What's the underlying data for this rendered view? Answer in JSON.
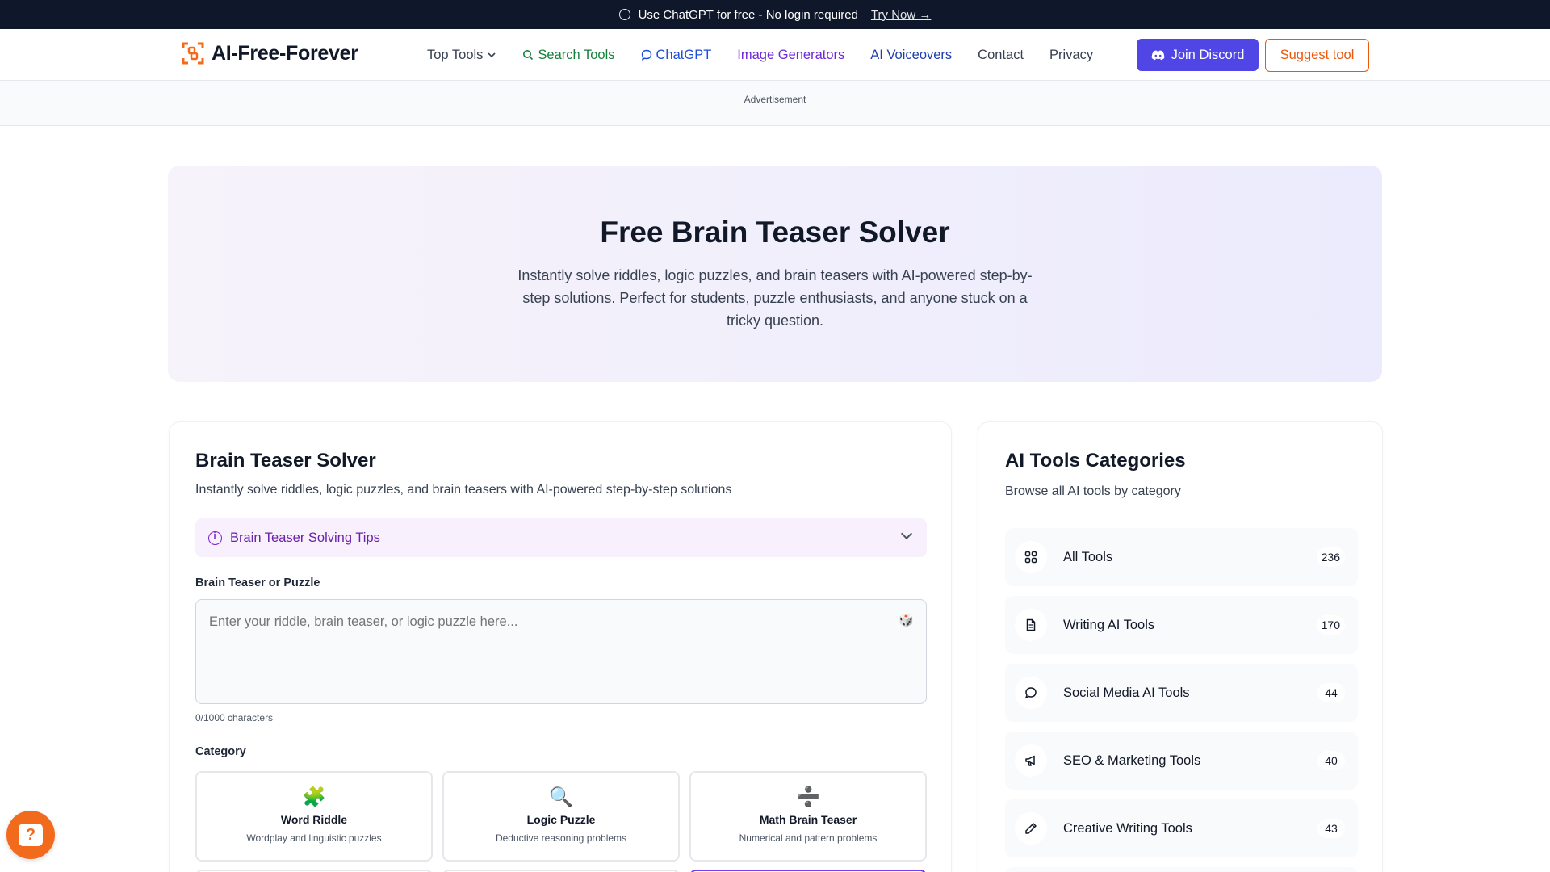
{
  "banner": {
    "text": "Use ChatGPT for free - No login required",
    "link": "Try Now →"
  },
  "brand": {
    "name": "AI-Free-Forever",
    "accent": "#f26b1d"
  },
  "nav": {
    "items": [
      {
        "label": "Top Tools",
        "icon": "chevron-down-icon"
      },
      {
        "label": "Search Tools",
        "icon": "search-icon"
      },
      {
        "label": "ChatGPT",
        "icon": "chat-icon"
      },
      {
        "label": "Image Generators"
      },
      {
        "label": "AI Voiceovers"
      },
      {
        "label": "Contact"
      },
      {
        "label": "Privacy"
      }
    ],
    "discord": "Join Discord",
    "suggest": "Suggest tool"
  },
  "ad_label": "Advertisement",
  "hero": {
    "title": "Free Brain Teaser Solver",
    "description": "Instantly solve riddles, logic puzzles, and brain teasers with AI-powered step-by-step solutions. Perfect for students, puzzle enthusiasts, and anyone stuck on a tricky question."
  },
  "solver": {
    "title": "Brain Teaser Solver",
    "subtitle": "Instantly solve riddles, logic puzzles, and brain teasers with AI-powered step-by-step solutions",
    "tips_label": "Brain Teaser Solving Tips",
    "input_label": "Brain Teaser or Puzzle",
    "input_placeholder": "Enter your riddle, brain teaser, or logic puzzle here...",
    "input_value": "",
    "char_count": "0/1000 characters",
    "category_label": "Category",
    "categories": [
      {
        "emoji": "🧩",
        "name": "Word Riddle",
        "desc": "Wordplay and linguistic puzzles"
      },
      {
        "emoji": "🔍",
        "name": "Logic Puzzle",
        "desc": "Deductive reasoning problems"
      },
      {
        "emoji": "➗",
        "name": "Math Brain Teaser",
        "desc": "Numerical and pattern problems"
      }
    ]
  },
  "sidebar": {
    "title": "AI Tools Categories",
    "subtitle": "Browse all AI tools by category",
    "items": [
      {
        "label": "All Tools",
        "count": "236",
        "icon": "grid-icon"
      },
      {
        "label": "Writing AI Tools",
        "count": "170",
        "icon": "document-icon"
      },
      {
        "label": "Social Media AI Tools",
        "count": "44",
        "icon": "chat-bubble-icon"
      },
      {
        "label": "SEO & Marketing Tools",
        "count": "40",
        "icon": "megaphone-icon"
      },
      {
        "label": "Creative Writing Tools",
        "count": "43",
        "icon": "pencil-icon"
      }
    ]
  }
}
